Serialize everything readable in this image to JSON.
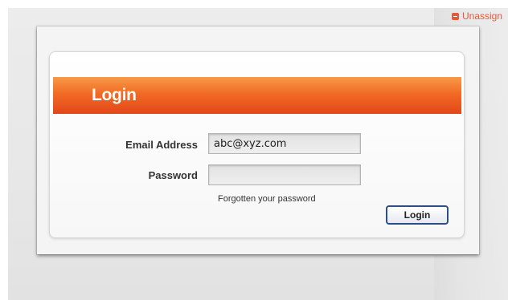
{
  "top_link": {
    "label": "Unassign",
    "icon": "minus-square-icon",
    "color": "#e25a3a"
  },
  "login_panel": {
    "title": "Login",
    "email_label": "Email Address",
    "email_value": "abc@xyz.com",
    "password_label": "Password",
    "password_value": "",
    "forgot_link": "Forgotten your password",
    "submit_label": "Login",
    "header_color": "#f26a25"
  }
}
